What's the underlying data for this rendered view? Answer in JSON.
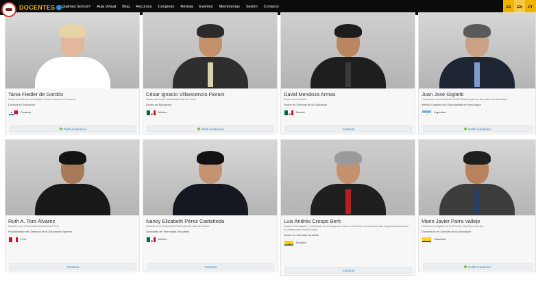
{
  "brand": {
    "name": "DOCENTES"
  },
  "nav": [
    "Quiénes Somos?",
    "Aula Virtual",
    "Blog",
    "Recursos",
    "Congreso",
    "Revista",
    "Eventos",
    "Membresías",
    "Sesión",
    "Contacto"
  ],
  "langs": [
    "ES",
    "EN",
    "PT"
  ],
  "cards": [
    {
      "name": "Tania Fiedler de Gordón",
      "desc": "Rectora Académica del Instituto Técnico Superior de Panamá",
      "degree": "Doctora en Educación",
      "country": "Panamá",
      "flag": "panama",
      "cta": "Perfil Académico",
      "cta_dot": true
    },
    {
      "name": "César Ignacio Villavicencio Florani",
      "desc": "Rector del Centro Universitario Mar de Cortés",
      "degree": "Doctor en Educación",
      "country": "México",
      "flag": "mexico",
      "cta": "Perfil Académico",
      "cta_dot": true
    },
    {
      "name": "David Mendoza Armas",
      "desc": "Rector de la UNIVIM",
      "degree": "Doctor en Ciencias de la Educación",
      "country": "México",
      "flag": "mexico",
      "cta": "Contacto",
      "cta_dot": false
    },
    {
      "name": "Juan José Giglietti",
      "desc": "Coordinador de la Sociedad CEMP (Estudio para las Neurociencias Aplicadas)",
      "degree": "Médico Cirujano con Especialidad en Neurología",
      "country": "Argentina",
      "flag": "argentina",
      "cta": "Perfil Académico",
      "cta_dot": true
    },
    {
      "name": "Ruth A. Toro Álvarez",
      "desc": "Docente de la Universidad Autónoma del Perú",
      "degree": "Posdoctorado en Gerencia de la Educación Superior",
      "country": "Perú",
      "flag": "peru",
      "cta": "Contacto",
      "cta_dot": false
    },
    {
      "name": "Nancy Elizabeth Pérez Castañeda",
      "desc": "Docente de la Universidad Politécnica del Valle de México",
      "degree": "Doctorado en Tecnología Educativa",
      "country": "México",
      "flag": "mexico",
      "cta": "Contacto",
      "cta_dot": false
    },
    {
      "name": "Luis Andrés Crespo Berti",
      "desc": "Docente-investigador y coordinador de investigación Carrera de Derecho de la Universidad Regional Autónoma de los Andes sede Ibarra-Ecuador",
      "degree": "Doctor en Ciencias Jurídicas",
      "country": "Ecuador",
      "flag": "ecuador",
      "cta": "Contacto",
      "cta_dot": false
    },
    {
      "name": "Mario Javier Parra Vallejo",
      "desc": "Docente investigador de la IER Juan José Pinto Jiménez",
      "degree": "Doctorando en Ciencias de la Educación",
      "country": "Colombia",
      "flag": "colombia",
      "cta": "Perfil Académico",
      "cta_dot": true
    }
  ]
}
